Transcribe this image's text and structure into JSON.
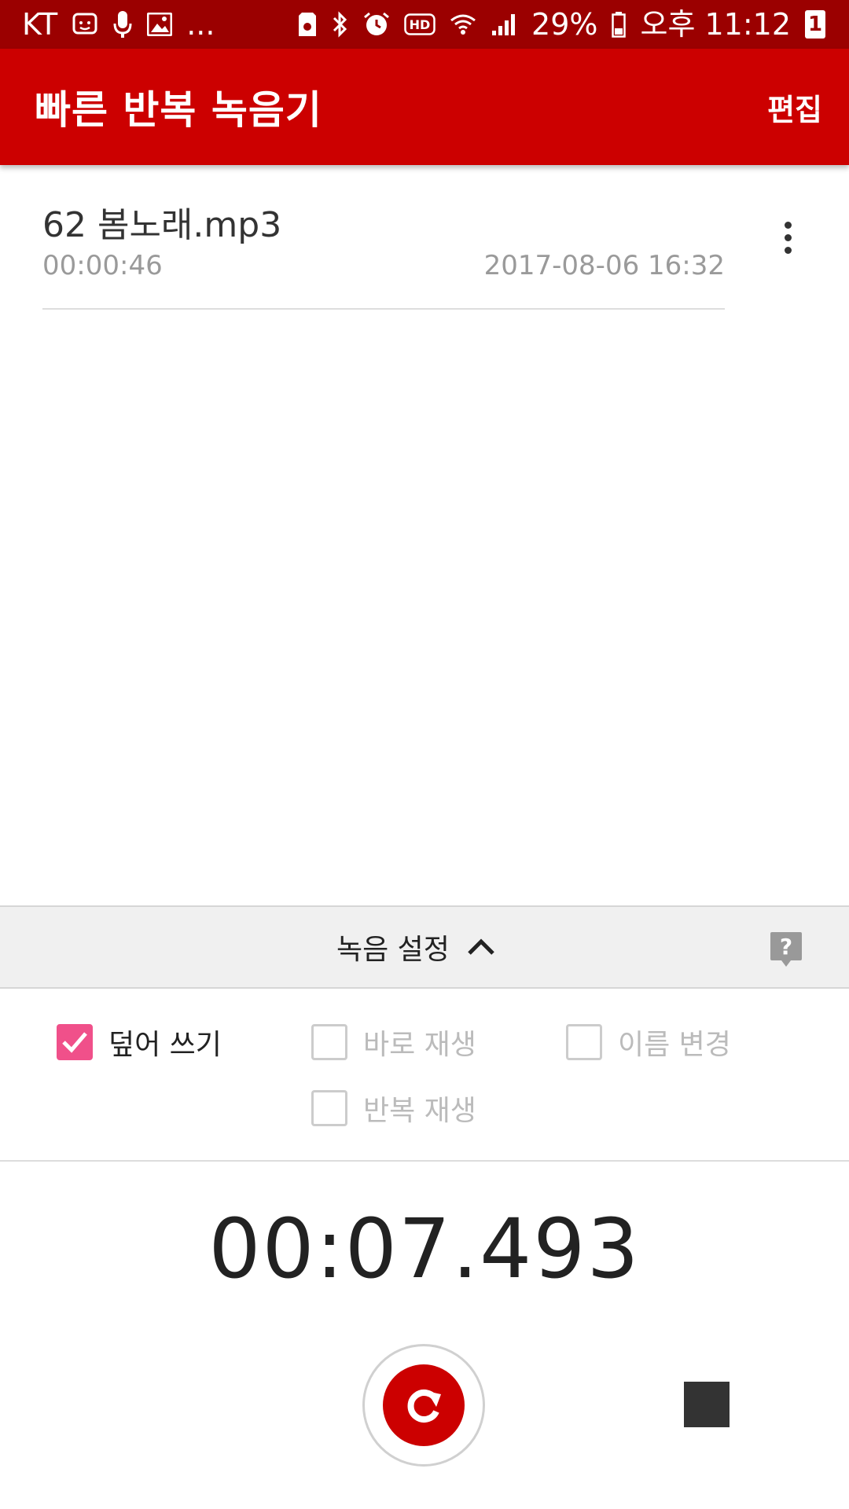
{
  "status_bar": {
    "carrier": "KT",
    "more": "...",
    "hd_label": "HD",
    "battery": "29%",
    "time": "오후 11:12",
    "notification_count": "1"
  },
  "app_bar": {
    "title": "빠른 반복 녹음기",
    "edit_label": "편집"
  },
  "recordings": [
    {
      "name": "62 봄노래.mp3",
      "duration": "00:00:46",
      "date": "2017-08-06 16:32"
    }
  ],
  "settings": {
    "title": "녹음 설정",
    "options": [
      {
        "label": "덮어 쓰기",
        "checked": true
      },
      {
        "label": "바로 재생",
        "checked": false
      },
      {
        "label": "이름 변경",
        "checked": false
      },
      {
        "label": "반복 재생",
        "checked": false
      }
    ]
  },
  "timer": "00:07.493",
  "colors": {
    "status_bar": "#9b0000",
    "app_bar": "#cc0000",
    "checkbox_checked": "#f0508a",
    "record_button": "#cc0000"
  },
  "icons": [
    "messenger-icon",
    "mic-icon",
    "image-icon",
    "nfc-icon",
    "bluetooth-icon",
    "alarm-icon",
    "hd-icon",
    "wifi-icon",
    "signal-icon",
    "battery-icon",
    "more-vert-icon",
    "chevron-up-icon",
    "help-icon",
    "redo-icon",
    "stop-icon"
  ]
}
